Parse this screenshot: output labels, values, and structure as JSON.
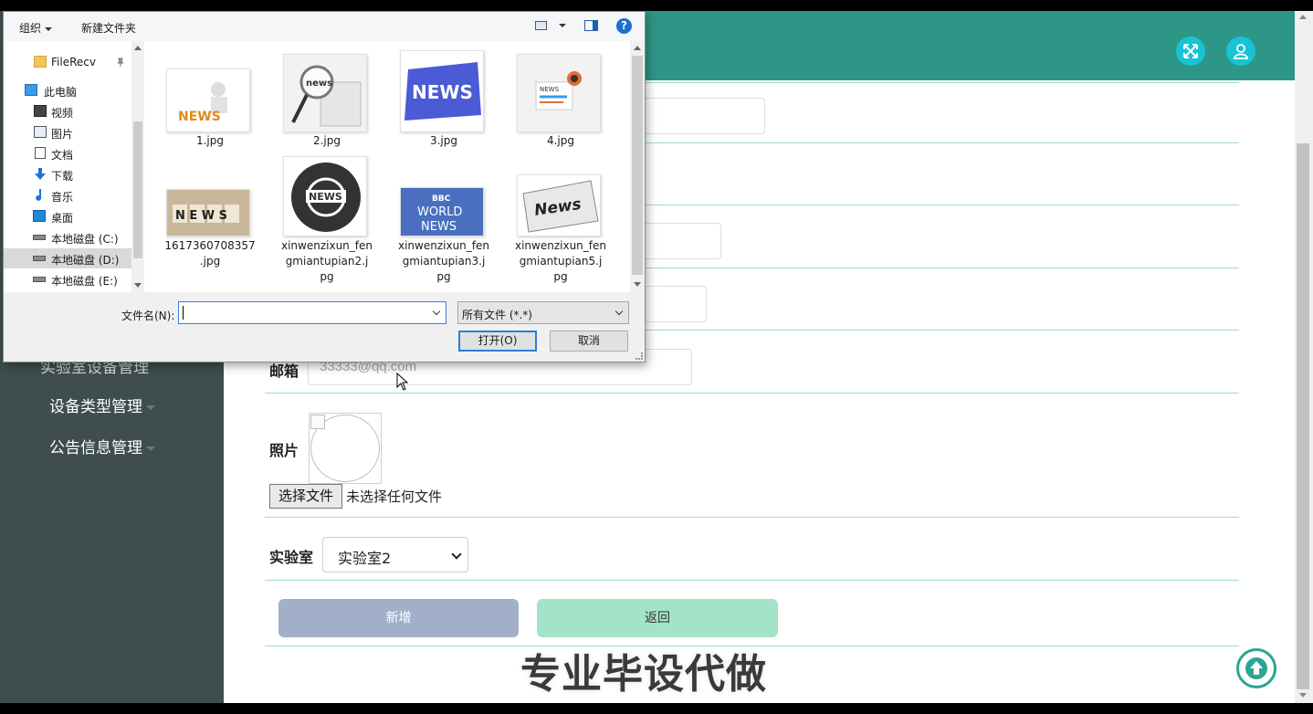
{
  "sidebar": {
    "items": [
      {
        "label": "实验室设备管理"
      },
      {
        "label": "设备类型管理"
      },
      {
        "label": "公告信息管理"
      }
    ]
  },
  "topbar": {
    "icons": [
      "fullscreen-icon",
      "user-icon"
    ]
  },
  "form": {
    "email": {
      "label": "邮箱",
      "placeholder": "33333@qq.com"
    },
    "photo": {
      "label": "照片",
      "choose_button": "选择文件",
      "no_file_text": "未选择任何文件"
    },
    "lab": {
      "label": "实验室",
      "selected": "实验室2"
    },
    "submit_label": "新增",
    "back_label": "返回"
  },
  "watermark": "专业毕设代做",
  "colors": {
    "topbar": "#2e9687",
    "sidebar": "#3f4d4e",
    "accent_button": "#18c3d4",
    "submit_button": "#a2afc9",
    "back_button": "#a3e4c9",
    "divider": "#9fdccc"
  },
  "dialog": {
    "toolbar": {
      "organize": "组织",
      "new_folder": "新建文件夹",
      "help": "?"
    },
    "nav": [
      {
        "label": "FileRecv",
        "icon": "folder-icon",
        "pinned": true
      },
      {
        "label": "此电脑",
        "icon": "computer-icon"
      },
      {
        "label": "视频",
        "icon": "video-icon"
      },
      {
        "label": "图片",
        "icon": "pictures-icon"
      },
      {
        "label": "文档",
        "icon": "documents-icon"
      },
      {
        "label": "下载",
        "icon": "download-icon"
      },
      {
        "label": "音乐",
        "icon": "music-icon"
      },
      {
        "label": "桌面",
        "icon": "desktop-icon"
      },
      {
        "label": "本地磁盘 (C:)",
        "icon": "drive-c-icon"
      },
      {
        "label": "本地磁盘 (D:)",
        "icon": "drive-d-icon",
        "selected": true
      },
      {
        "label": "本地磁盘 (E:)",
        "icon": "drive-e-icon"
      }
    ],
    "files": [
      {
        "name": "1.jpg"
      },
      {
        "name": "2.jpg"
      },
      {
        "name": "3.jpg"
      },
      {
        "name": "4.jpg"
      },
      {
        "name": "1617360708357\n.jpg"
      },
      {
        "name": "xinwenzixun_fen\ngmiantupian2.j\npg"
      },
      {
        "name": "xinwenzixun_fen\ngmiantupian3.j\npg"
      },
      {
        "name": "xinwenzixun_fen\ngmiantupian5.j\npg"
      }
    ],
    "filename_label": "文件名(N):",
    "filename_value": "",
    "filetype": "所有文件 (*.*)",
    "open_button": "打开(O)",
    "cancel_button": "取消"
  }
}
